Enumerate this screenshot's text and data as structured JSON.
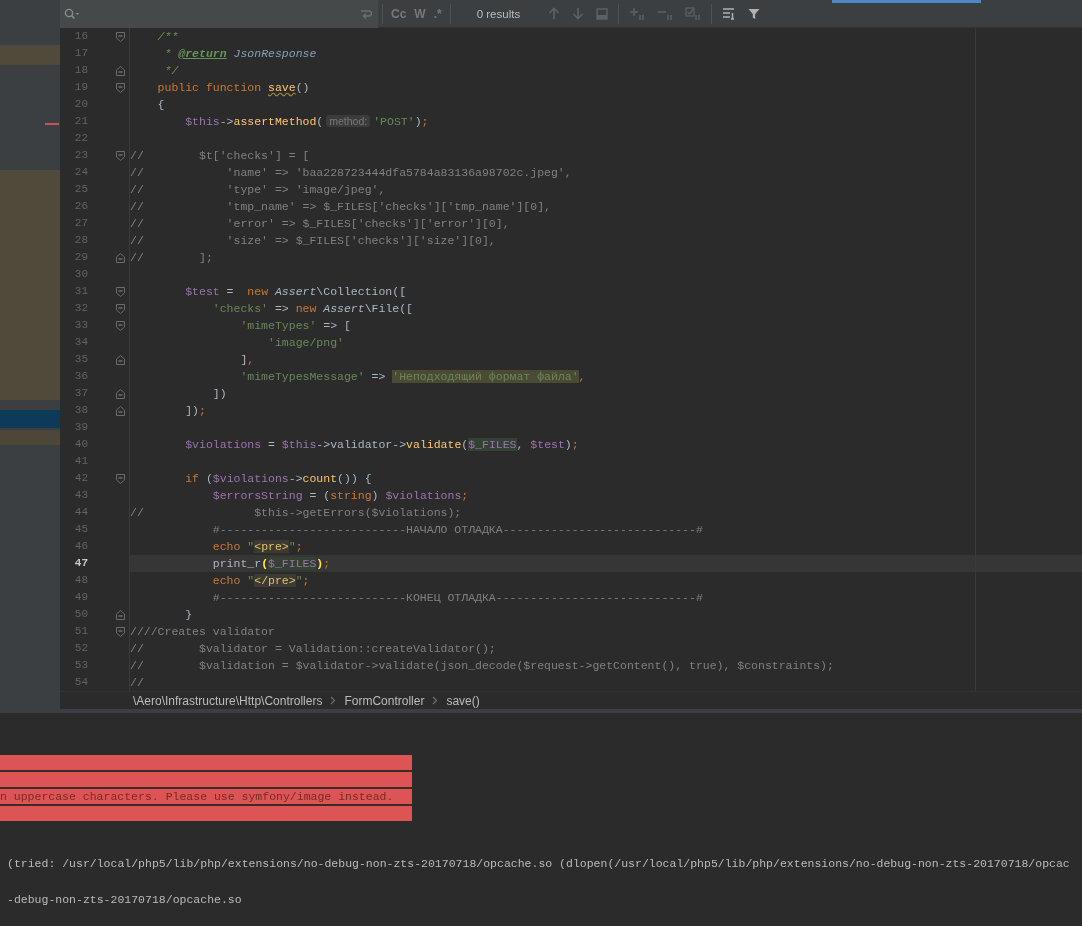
{
  "toolbar": {
    "options": [
      "Cc",
      "W",
      ".*"
    ],
    "results": "0 results"
  },
  "lines": [
    {
      "number": "16",
      "fold_start": true,
      "fold_end": false,
      "current": false,
      "tokens": [
        {
          "kind": "doc",
          "text": "    /**"
        }
      ]
    },
    {
      "number": "17",
      "fold_start": false,
      "fold_end": false,
      "current": false,
      "tokens": [
        {
          "kind": "doc",
          "text": "     * "
        },
        {
          "kind": "doctag",
          "text": "@return"
        },
        {
          "kind": "doctype",
          "text": " JsonResponse"
        }
      ]
    },
    {
      "number": "18",
      "fold_start": false,
      "fold_end": true,
      "current": false,
      "tokens": [
        {
          "kind": "doc",
          "text": "     */"
        }
      ]
    },
    {
      "number": "19",
      "fold_start": true,
      "fold_end": false,
      "current": false,
      "tokens": [
        {
          "kind": "keyword",
          "text": "    public function "
        },
        {
          "kind": "funcwarn",
          "text": "save"
        },
        {
          "kind": "plain",
          "text": "()"
        }
      ]
    },
    {
      "number": "20",
      "fold_start": false,
      "fold_end": false,
      "current": false,
      "tokens": [
        {
          "kind": "plain",
          "text": "    {"
        }
      ]
    },
    {
      "number": "21",
      "fold_start": false,
      "fold_end": false,
      "current": false,
      "tokens": [
        {
          "kind": "var",
          "text": "        $this"
        },
        {
          "kind": "plain",
          "text": "->"
        },
        {
          "kind": "func",
          "text": "assertMethod"
        },
        {
          "kind": "plain",
          "text": "("
        },
        {
          "kind": "hint",
          "text": "method:"
        },
        {
          "kind": "string",
          "text": "'POST'"
        },
        {
          "kind": "plain",
          "text": ")"
        },
        {
          "kind": "keyword",
          "text": ";"
        }
      ]
    },
    {
      "number": "22",
      "fold_start": false,
      "fold_end": false,
      "current": false
    },
    {
      "number": "23",
      "fold_start": true,
      "fold_end": false,
      "current": false,
      "tokens": [
        {
          "kind": "comment",
          "text": "//        $t['checks'] = ["
        }
      ]
    },
    {
      "number": "24",
      "fold_start": false,
      "fold_end": false,
      "current": false,
      "tokens": [
        {
          "kind": "comment",
          "text": "//            'name' => 'baa228723444dfa5784a83136a98702c.jpeg',"
        }
      ]
    },
    {
      "number": "25",
      "fold_start": false,
      "fold_end": false,
      "current": false,
      "tokens": [
        {
          "kind": "comment",
          "text": "//            'type' => 'image/jpeg',"
        }
      ]
    },
    {
      "number": "26",
      "fold_start": false,
      "fold_end": false,
      "current": false,
      "tokens": [
        {
          "kind": "comment",
          "text": "//            'tmp_name' => $_FILES['checks']['tmp_name'][0],"
        }
      ]
    },
    {
      "number": "27",
      "fold_start": false,
      "fold_end": false,
      "current": false,
      "tokens": [
        {
          "kind": "comment",
          "text": "//            'error' => $_FILES['checks']['error'][0],"
        }
      ]
    },
    {
      "number": "28",
      "fold_start": false,
      "fold_end": false,
      "current": false,
      "tokens": [
        {
          "kind": "comment",
          "text": "//            'size' => $_FILES['checks']['size'][0],"
        }
      ]
    },
    {
      "number": "29",
      "fold_start": false,
      "fold_end": true,
      "current": false,
      "tokens": [
        {
          "kind": "comment",
          "text": "//        ];"
        }
      ]
    },
    {
      "number": "30",
      "fold_start": false,
      "fold_end": false,
      "current": false
    },
    {
      "number": "31",
      "fold_start": true,
      "fold_end": false,
      "current": false,
      "tokens": [
        {
          "kind": "var",
          "text": "        $test"
        },
        {
          "kind": "plain",
          "text": " =  "
        },
        {
          "kind": "keyword",
          "text": "new "
        },
        {
          "kind": "klass",
          "text": "Assert"
        },
        {
          "kind": "plain",
          "text": "\\Collection(["
        }
      ]
    },
    {
      "number": "32",
      "fold_start": true,
      "fold_end": false,
      "current": false,
      "tokens": [
        {
          "kind": "string",
          "text": "            'checks'"
        },
        {
          "kind": "plain",
          "text": " => "
        },
        {
          "kind": "keyword",
          "text": "new "
        },
        {
          "kind": "klass",
          "text": "Assert"
        },
        {
          "kind": "plain",
          "text": "\\File(["
        }
      ]
    },
    {
      "number": "33",
      "fold_start": true,
      "fold_end": false,
      "current": false,
      "tokens": [
        {
          "kind": "string",
          "text": "                'mimeTypes'"
        },
        {
          "kind": "plain",
          "text": " => ["
        }
      ]
    },
    {
      "number": "34",
      "fold_start": false,
      "fold_end": false,
      "current": false,
      "tokens": [
        {
          "kind": "string",
          "text": "                    'image/png'"
        }
      ]
    },
    {
      "number": "35",
      "fold_start": false,
      "fold_end": true,
      "current": false,
      "tokens": [
        {
          "kind": "plain",
          "text": "                ]"
        },
        {
          "kind": "keyword",
          "text": ","
        }
      ]
    },
    {
      "number": "36",
      "fold_start": false,
      "fold_end": false,
      "current": false,
      "tokens": [
        {
          "kind": "string",
          "text": "                'mimeTypesMessage'"
        },
        {
          "kind": "plain",
          "text": " => "
        },
        {
          "kind": "string_hl",
          "text": "'Неподходящий формат файла'"
        },
        {
          "kind": "keyword",
          "text": ","
        }
      ]
    },
    {
      "number": "37",
      "fold_start": false,
      "fold_end": true,
      "current": false,
      "tokens": [
        {
          "kind": "plain",
          "text": "            ])"
        }
      ]
    },
    {
      "number": "38",
      "fold_start": false,
      "fold_end": true,
      "current": false,
      "tokens": [
        {
          "kind": "plain",
          "text": "        ])"
        },
        {
          "kind": "keyword",
          "text": ";"
        }
      ]
    },
    {
      "number": "39",
      "fold_start": false,
      "fold_end": false,
      "current": false
    },
    {
      "number": "40",
      "fold_start": false,
      "fold_end": false,
      "current": false,
      "tokens": [
        {
          "kind": "var",
          "text": "        $violations"
        },
        {
          "kind": "plain",
          "text": " = "
        },
        {
          "kind": "var",
          "text": "$this"
        },
        {
          "kind": "plain",
          "text": "->validator->"
        },
        {
          "kind": "func",
          "text": "validate"
        },
        {
          "kind": "plain",
          "text": "("
        },
        {
          "kind": "usage",
          "text": "$_FILES"
        },
        {
          "kind": "plain",
          "text": ", "
        },
        {
          "kind": "var",
          "text": "$test"
        },
        {
          "kind": "plain",
          "text": ")"
        },
        {
          "kind": "keyword",
          "text": ";"
        }
      ]
    },
    {
      "number": "41",
      "fold_start": false,
      "fold_end": false,
      "current": false
    },
    {
      "number": "42",
      "fold_start": true,
      "fold_end": false,
      "current": false,
      "tokens": [
        {
          "kind": "keyword",
          "text": "        if "
        },
        {
          "kind": "plain",
          "text": "("
        },
        {
          "kind": "var",
          "text": "$violations"
        },
        {
          "kind": "plain",
          "text": "->"
        },
        {
          "kind": "func",
          "text": "count"
        },
        {
          "kind": "plain",
          "text": "()) {"
        }
      ]
    },
    {
      "number": "43",
      "fold_start": false,
      "fold_end": false,
      "current": false,
      "tokens": [
        {
          "kind": "var",
          "text": "            $errorsString"
        },
        {
          "kind": "plain",
          "text": " = ("
        },
        {
          "kind": "keyword",
          "text": "string"
        },
        {
          "kind": "plain",
          "text": ") "
        },
        {
          "kind": "var",
          "text": "$violations"
        },
        {
          "kind": "keyword",
          "text": ";"
        }
      ]
    },
    {
      "number": "44",
      "fold_start": false,
      "fold_end": false,
      "current": false,
      "tokens": [
        {
          "kind": "comment",
          "text": "//                $this->getErrors($violations);"
        }
      ]
    },
    {
      "number": "45",
      "fold_start": false,
      "fold_end": false,
      "current": false,
      "tokens": [
        {
          "kind": "comment",
          "text": "            #---------------------------НАЧАЛО ОТЛАДКА----------------------------#"
        }
      ]
    },
    {
      "number": "46",
      "fold_start": false,
      "fold_end": false,
      "current": false,
      "tokens": [
        {
          "kind": "keyword",
          "text": "            echo "
        },
        {
          "kind": "string",
          "text": "\""
        },
        {
          "kind": "tag",
          "text": "<pre>"
        },
        {
          "kind": "string",
          "text": "\""
        },
        {
          "kind": "keyword",
          "text": ";"
        }
      ]
    },
    {
      "number": "47",
      "fold_start": false,
      "fold_end": false,
      "current": true,
      "tokens": [
        {
          "kind": "plain",
          "text": "            print_r"
        },
        {
          "kind": "brace",
          "text": "("
        },
        {
          "kind": "usage",
          "text": "$_FILES"
        },
        {
          "kind": "brace",
          "text": ")"
        },
        {
          "kind": "keyword",
          "text": ";"
        }
      ]
    },
    {
      "number": "48",
      "fold_start": false,
      "fold_end": false,
      "current": false,
      "tokens": [
        {
          "kind": "keyword",
          "text": "            echo "
        },
        {
          "kind": "string",
          "text": "\""
        },
        {
          "kind": "tag",
          "text": "</pre>"
        },
        {
          "kind": "string",
          "text": "\""
        },
        {
          "kind": "keyword",
          "text": ";"
        }
      ]
    },
    {
      "number": "49",
      "fold_start": false,
      "fold_end": false,
      "current": false,
      "tokens": [
        {
          "kind": "comment",
          "text": "            #---------------------------КОНЕЦ ОТЛАДКА-----------------------------#"
        }
      ]
    },
    {
      "number": "50",
      "fold_start": false,
      "fold_end": true,
      "current": false,
      "tokens": [
        {
          "kind": "plain",
          "text": "        }"
        }
      ]
    },
    {
      "number": "51",
      "fold_start": true,
      "fold_end": false,
      "current": false,
      "tokens": [
        {
          "kind": "comment",
          "text": "////Creates validator"
        }
      ]
    },
    {
      "number": "52",
      "fold_start": false,
      "fold_end": false,
      "current": false,
      "tokens": [
        {
          "kind": "comment",
          "text": "//        $validator = Validation::createValidator();"
        }
      ]
    },
    {
      "number": "53",
      "fold_start": false,
      "fold_end": false,
      "current": false,
      "tokens": [
        {
          "kind": "comment",
          "text": "//        $validation = $validator->validate(json_decode($request->getContent(), true), $constraints);"
        }
      ]
    },
    {
      "number": "54",
      "fold_start": false,
      "fold_end": false,
      "current": false,
      "tokens": [
        {
          "kind": "comment",
          "text": "//"
        }
      ]
    }
  ],
  "breadcrumbs": [
    "\\Aero\\Infrastructure\\Http\\Controllers",
    "FormController",
    "save()"
  ],
  "error_block": [
    {
      "kind": "blank"
    },
    {
      "kind": "blank"
    },
    {
      "kind": "text",
      "text": "n uppercase characters. Please use symfony/image instead."
    },
    {
      "kind": "blank"
    }
  ],
  "console_lines": [
    "(tried: /usr/local/php5/lib/php/extensions/no-debug-non-zts-20170718/opcache.so (dlopen(/usr/local/php5/lib/php/extensions/no-debug-non-zts-20170718/opcac",
    "-debug-non-zts-20170718/opcache.so"
  ]
}
